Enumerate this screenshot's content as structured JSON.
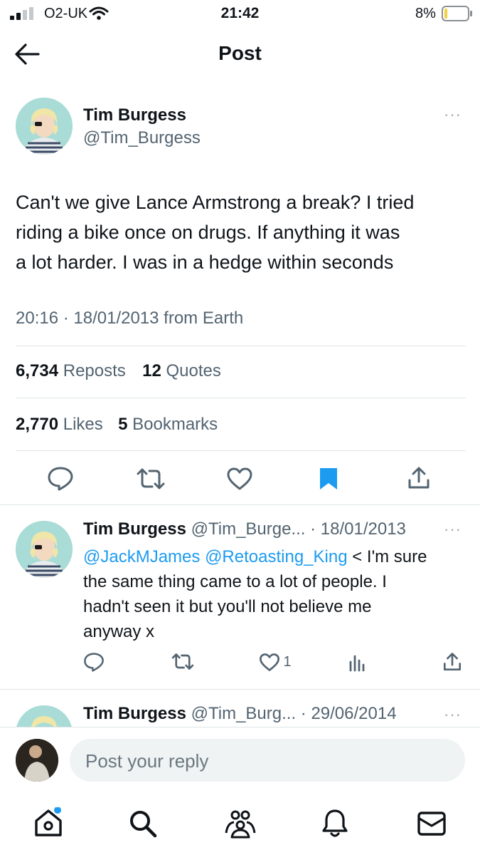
{
  "status_bar": {
    "carrier": "O2-UK",
    "time": "21:42",
    "battery": "8%"
  },
  "header": {
    "title": "Post"
  },
  "post": {
    "display_name": "Tim Burgess",
    "handle": "@Tim_Burgess",
    "text_lines": [
      "Can't we give Lance Armstrong a break? I tried",
      "riding a bike once on drugs. If anything it was",
      "a lot harder. I was in a hedge within seconds"
    ],
    "meta": "20:16 · 18/01/2013 from Earth",
    "reposts_count": "6,734",
    "reposts_label": "Reposts",
    "quotes_count": "12",
    "quotes_label": "Quotes",
    "likes_count": "2,770",
    "likes_label": "Likes",
    "bookmarks_count": "5",
    "bookmarks_label": "Bookmarks",
    "more": "···"
  },
  "replies": [
    {
      "display_name": "Tim Burgess",
      "handle_date": "@Tim_Burge... · 18/01/2013",
      "mention1": "@JackMJames",
      "mention2": "@Retoasting_King",
      "text_first": " < I'm sure",
      "text_lines": [
        "the same thing came to a lot of people. I",
        "hadn't seen it  but you'll not believe me",
        "anyway x"
      ],
      "like_count": "1",
      "more": "···"
    },
    {
      "display_name": "Tim Burgess",
      "handle_date": "@Tim_Burg... · 29/06/2014",
      "more": "···"
    }
  ],
  "reply_box": {
    "placeholder": "Post your reply"
  },
  "colors": {
    "accent": "#1d9bf0",
    "muted": "#536471",
    "divider": "#dfe5e8",
    "battery_low": "#f4d03f"
  }
}
